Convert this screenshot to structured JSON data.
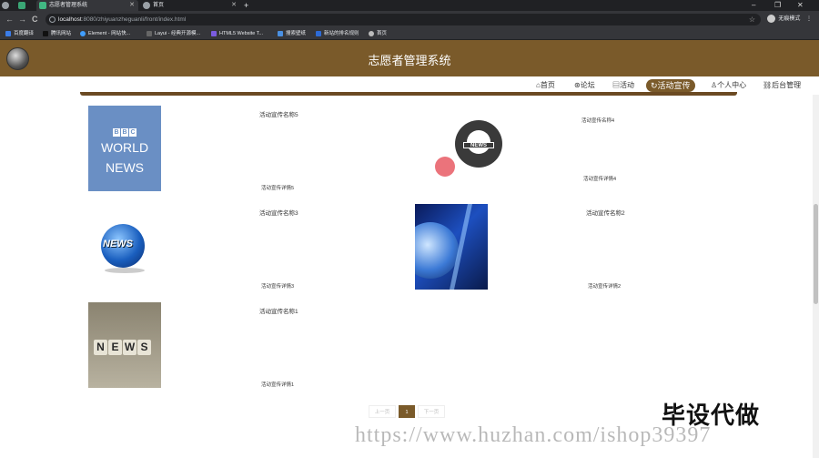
{
  "browser": {
    "tabs": [
      {
        "label": "志愿者管理系统",
        "active": true
      },
      {
        "label": "首页",
        "active": false
      }
    ],
    "new_tab": "+",
    "window_controls": {
      "minimize": "–",
      "restore": "❐",
      "close": "✕"
    },
    "nav": {
      "back": "←",
      "forward": "→",
      "reload": "C"
    },
    "url_host": "localhost",
    "url_rest": ":8080/zhiyuanzheguanli/front/index.html",
    "profile_label": "无痕模式",
    "bookmarks": [
      {
        "label": "百度翻译",
        "color": "#3b7de8"
      },
      {
        "label": "腾讯网站",
        "color": "#333333"
      },
      {
        "label": "Element - 网站快...",
        "color": "#409eff"
      },
      {
        "label": "Layui - 经典开源模...",
        "color": "#555555"
      },
      {
        "label": "HTML5 Website T...",
        "color": "#7b5ce0"
      },
      {
        "label": "搜索壁纸",
        "color": "#4a90e2"
      },
      {
        "label": "新站的排名规则",
        "color": "#2d6bd6"
      },
      {
        "label": "首页",
        "color": "#bbbbbb"
      }
    ]
  },
  "site": {
    "title": "志愿者管理系统",
    "accent": "#7a5a2a",
    "nav": [
      {
        "label": "首页",
        "icon": "home-icon",
        "active": false
      },
      {
        "label": "论坛",
        "icon": "forum-icon",
        "active": false
      },
      {
        "label": "活动",
        "icon": "activity-icon",
        "active": false
      },
      {
        "label": "活动宣传",
        "icon": "promo-icon",
        "active": true
      },
      {
        "label": "个人中心",
        "icon": "user-icon",
        "active": false
      },
      {
        "label": "后台管理",
        "icon": "link-icon",
        "active": false
      }
    ]
  },
  "cards": [
    {
      "name": "活动宣传名称5",
      "detail": "活动宣传详情5",
      "image": "bbc-world-news"
    },
    {
      "name": "活动宣传名称4",
      "detail": "活动宣传详情4",
      "image": "news-globe-icon"
    },
    {
      "name": "活动宣传名称3",
      "detail": "活动宣传详情3",
      "image": "blue-news-globe"
    },
    {
      "name": "活动宣传名称2",
      "detail": "活动宣传详情2",
      "image": "tech-earth"
    },
    {
      "name": "活动宣传名称1",
      "detail": "活动宣传详情1",
      "image": "news-dice"
    }
  ],
  "images": {
    "bbc_blocks": [
      "B",
      "B",
      "C"
    ],
    "bbc_line1": "WORLD",
    "bbc_line2": "NEWS",
    "news_tag": "NEWS",
    "globe_text": "NEWS",
    "dice_letters": [
      "N",
      "E",
      "W",
      "S"
    ]
  },
  "pagination": {
    "prev": "上一页",
    "current": "1",
    "next": "下一页"
  },
  "watermark": {
    "brand": "毕设代做",
    "url": "https://www.huzhan.com/ishop39397"
  }
}
